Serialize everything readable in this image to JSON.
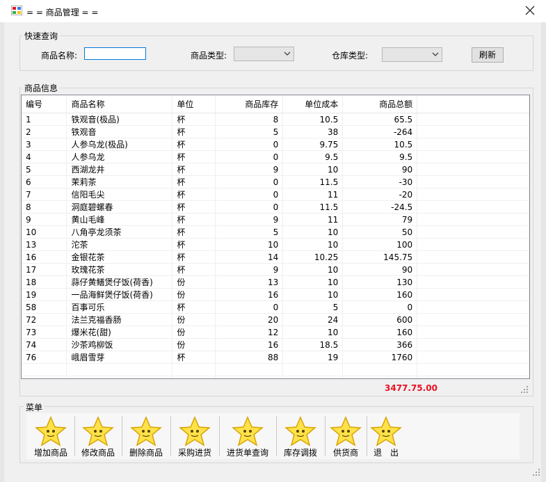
{
  "window": {
    "title": "= = 商品管理 = ="
  },
  "quick_search": {
    "legend": "快速查询",
    "name_label": "商品名称:",
    "name_value": "",
    "type_label": "商品类型:",
    "type_selected": "",
    "warehouse_label": "仓库类型:",
    "warehouse_selected": "",
    "refresh_label": "刷新"
  },
  "product_info": {
    "legend": "商品信息",
    "columns": [
      "编号",
      "商品名称",
      "单位",
      "商品库存",
      "单位成本",
      "商品总额"
    ],
    "rows": [
      [
        "1",
        "铁观音(极品)",
        "杯",
        "8",
        "10.5",
        "65.5"
      ],
      [
        "2",
        "铁观音",
        "杯",
        "5",
        "38",
        "-264"
      ],
      [
        "3",
        "人参乌龙(极品)",
        "杯",
        "0",
        "9.75",
        "10.5"
      ],
      [
        "4",
        "人参乌龙",
        "杯",
        "0",
        "9.5",
        "9.5"
      ],
      [
        "5",
        "西湖龙井",
        "杯",
        "9",
        "10",
        "90"
      ],
      [
        "6",
        "茉莉茶",
        "杯",
        "0",
        "11.5",
        "-30"
      ],
      [
        "7",
        "信阳毛尖",
        "杯",
        "0",
        "11",
        "-20"
      ],
      [
        "8",
        "洞庭碧螺春",
        "杯",
        "0",
        "11.5",
        "-24.5"
      ],
      [
        "9",
        "黄山毛峰",
        "杯",
        "9",
        "11",
        "79"
      ],
      [
        "10",
        "八角亭龙须茶",
        "杯",
        "5",
        "10",
        "50"
      ],
      [
        "13",
        "沱茶",
        "杯",
        "10",
        "10",
        "100"
      ],
      [
        "16",
        "金银花茶",
        "杯",
        "14",
        "10.25",
        "145.75"
      ],
      [
        "17",
        "玫瑰花茶",
        "杯",
        "9",
        "10",
        "90"
      ],
      [
        "18",
        "蒜仔黄鳝煲仔饭(荷香)",
        "份",
        "13",
        "10",
        "130"
      ],
      [
        "19",
        "一品海鲜煲仔饭(荷香)",
        "份",
        "16",
        "10",
        "160"
      ],
      [
        "58",
        "百事可乐",
        "杯",
        "0",
        "5",
        "0"
      ],
      [
        "72",
        "法兰克福香肠",
        "份",
        "20",
        "24",
        "600"
      ],
      [
        "73",
        "爆米花(甜)",
        "份",
        "12",
        "10",
        "160"
      ],
      [
        "74",
        "沙茶鸡柳饭",
        "份",
        "16",
        "18.5",
        "366"
      ],
      [
        "76",
        "峨眉雪芽",
        "杯",
        "88",
        "19",
        "1760"
      ]
    ],
    "total": "3477.75.00"
  },
  "menu": {
    "legend": "菜单",
    "icon": "star-face-icon",
    "buttons": [
      "增加商品",
      "修改商品",
      "删除商品",
      "采购进货",
      "进货单查询",
      "库存调拨",
      "供货商",
      "退　出"
    ]
  },
  "colors": {
    "accent": "#0078d7",
    "total": "#e81123",
    "star": "#ffe24a"
  }
}
